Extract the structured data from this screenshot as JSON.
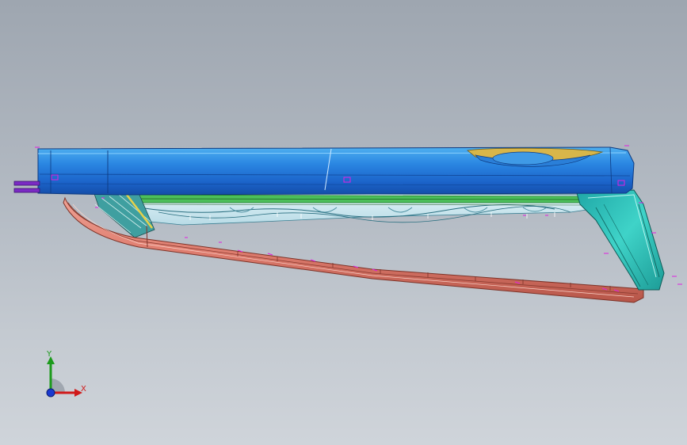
{
  "viewport": {
    "background_top": "#9ea6b0",
    "background_bottom": "#cfd4da"
  },
  "model": {
    "part_colors": {
      "top_rail": "#1f6fd6",
      "top_rail_highlight": "#58b6f2",
      "inner_panel": "#6fd06f",
      "inner_panel_light": "#cfe9f2",
      "end_bracket": "#29bdb7",
      "lower_strip": "#e08478",
      "lower_strip_edge": "#8a3b30",
      "sketch_markers": "#e020e0",
      "rod": "#7b2ac4"
    }
  },
  "triad": {
    "y_label": "Y",
    "x_label": "X",
    "y_color": "#1c9a1c",
    "x_color": "#d01a1a",
    "z_color": "#1a3ad0"
  }
}
